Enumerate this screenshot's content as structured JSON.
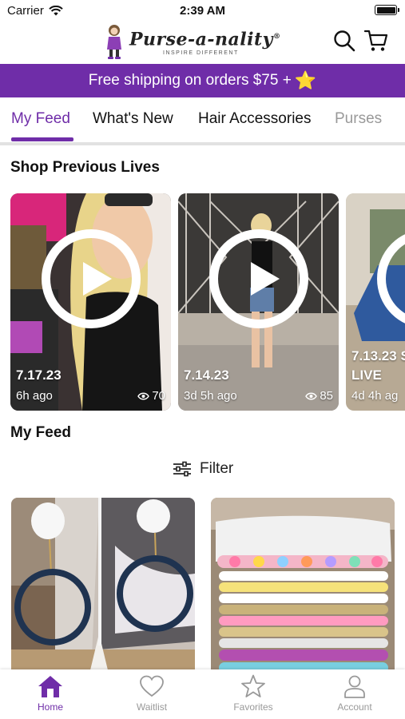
{
  "status_bar": {
    "carrier": "Carrier",
    "time": "2:39 AM"
  },
  "header": {
    "brand": "Purse-a-nality",
    "brand_mark": "®",
    "tagline": "INSPIRE DIFFERENT",
    "icons": [
      "search-icon",
      "cart-icon"
    ]
  },
  "promo": {
    "text": "Free shipping on orders $75 +",
    "emoji": "⭐"
  },
  "tabs": [
    {
      "label": "My Feed",
      "active": true
    },
    {
      "label": "What's New"
    },
    {
      "label": "Hair Accessories"
    },
    {
      "label": "Purses"
    }
  ],
  "shop_previous_lives": {
    "title": "Shop Previous Lives",
    "cards": [
      {
        "date": "7.17.23",
        "ago": "6h ago",
        "views": "70"
      },
      {
        "date": "7.14.23",
        "ago": "3d 5h ago",
        "views": "85"
      },
      {
        "date": "7.13.23 S",
        "subtitle": "LIVE",
        "ago": "4d 4h ag"
      }
    ]
  },
  "my_feed": {
    "title": "My Feed",
    "filter_label": "Filter"
  },
  "bottom_nav": [
    {
      "label": "Home",
      "icon": "home-icon",
      "active": true
    },
    {
      "label": "Waitlist",
      "icon": "heart-icon"
    },
    {
      "label": "Favorites",
      "icon": "star-icon"
    },
    {
      "label": "Account",
      "icon": "account-icon"
    }
  ],
  "colors": {
    "brand_purple": "#6f2da8",
    "inactive_gray": "#999999"
  }
}
